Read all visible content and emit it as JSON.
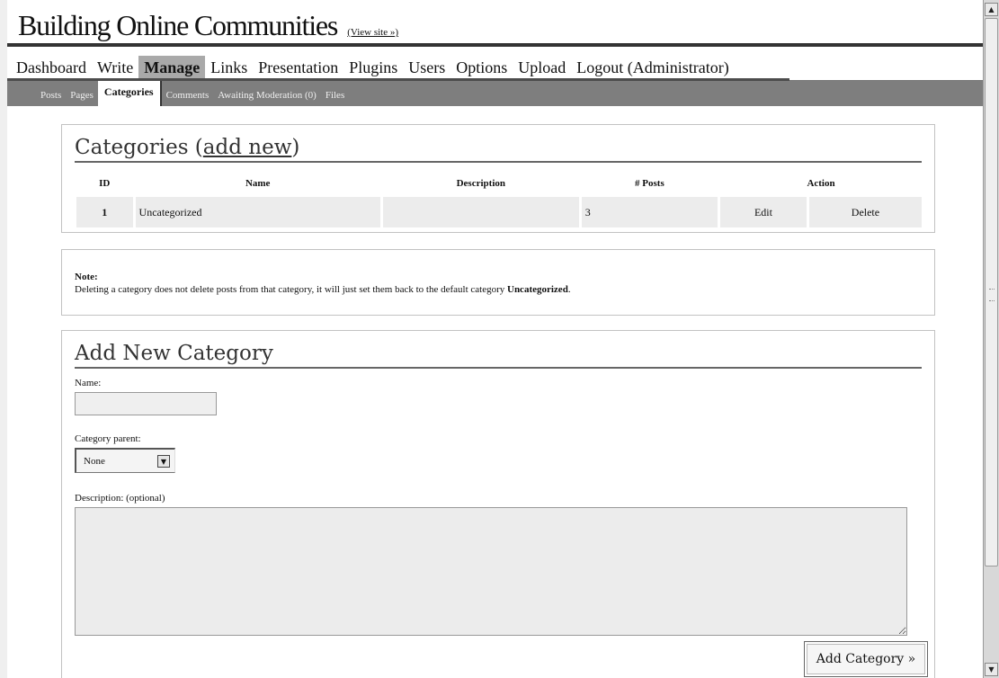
{
  "header": {
    "site_title": "Building Online Communities",
    "view_site": "(View site »)"
  },
  "main_nav": [
    {
      "label": "Dashboard",
      "active": false
    },
    {
      "label": "Write",
      "active": false
    },
    {
      "label": "Manage",
      "active": true
    },
    {
      "label": "Links",
      "active": false
    },
    {
      "label": "Presentation",
      "active": false
    },
    {
      "label": "Plugins",
      "active": false
    },
    {
      "label": "Users",
      "active": false
    },
    {
      "label": "Options",
      "active": false
    },
    {
      "label": "Upload",
      "active": false
    },
    {
      "label": "Logout (Administrator)",
      "active": false
    }
  ],
  "sub_nav": [
    {
      "label": "Posts",
      "active": false
    },
    {
      "label": "Pages",
      "active": false
    },
    {
      "label": "Categories",
      "active": true
    },
    {
      "label": "Comments",
      "active": false
    },
    {
      "label": "Awaiting Moderation (0)",
      "active": false
    },
    {
      "label": "Files",
      "active": false
    }
  ],
  "categories": {
    "heading_prefix": "Categories (",
    "heading_link": "add new",
    "heading_suffix": ")",
    "columns": [
      "ID",
      "Name",
      "Description",
      "# Posts",
      "Action"
    ],
    "rows": [
      {
        "id": "1",
        "name": "Uncategorized",
        "description": "",
        "posts": "3",
        "edit": "Edit",
        "delete": "Delete"
      }
    ]
  },
  "note": {
    "title": "Note:",
    "text_before": "Deleting a category does not delete posts from that category, it will just set them back to the default category ",
    "text_bold": "Uncategorized",
    "text_after": "."
  },
  "add_form": {
    "heading": "Add New Category",
    "name_label": "Name:",
    "name_value": "",
    "parent_label": "Category parent:",
    "parent_selected": "None",
    "description_label": "Description: (optional)",
    "description_value": "",
    "submit_label": "Add Category »"
  }
}
